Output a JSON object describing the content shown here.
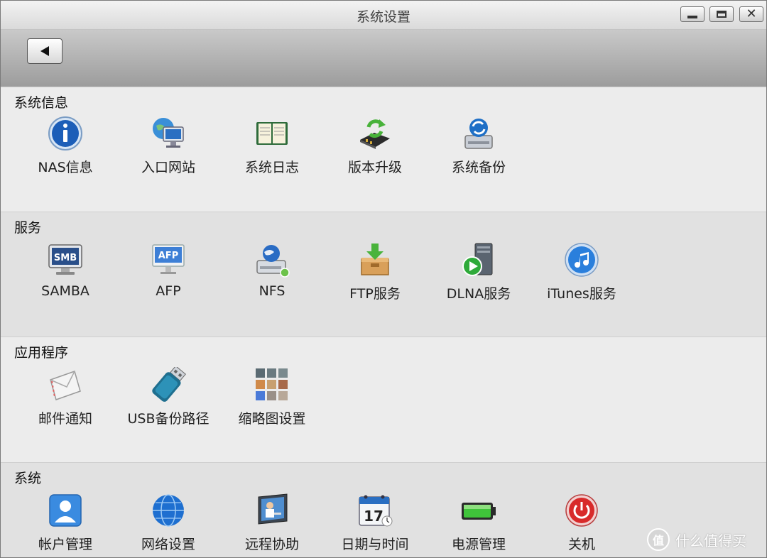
{
  "window": {
    "title": "系统设置"
  },
  "sections": [
    {
      "title": "系统信息",
      "items": [
        {
          "label": "NAS信息",
          "icon": "info-icon"
        },
        {
          "label": "入口网站",
          "icon": "web-portal-icon"
        },
        {
          "label": "系统日志",
          "icon": "log-book-icon"
        },
        {
          "label": "版本升级",
          "icon": "firmware-upgrade-icon"
        },
        {
          "label": "系统备份",
          "icon": "system-backup-icon"
        }
      ]
    },
    {
      "title": "服务",
      "items": [
        {
          "label": "SAMBA",
          "icon": "samba-icon",
          "text": "SMB"
        },
        {
          "label": "AFP",
          "icon": "afp-icon",
          "text": "AFP"
        },
        {
          "label": "NFS",
          "icon": "nfs-icon"
        },
        {
          "label": "FTP服务",
          "icon": "ftp-icon"
        },
        {
          "label": "DLNA服务",
          "icon": "dlna-icon"
        },
        {
          "label": "iTunes服务",
          "icon": "itunes-icon"
        }
      ]
    },
    {
      "title": "应用程序",
      "items": [
        {
          "label": "邮件通知",
          "icon": "mail-icon"
        },
        {
          "label": "USB备份路径",
          "icon": "usb-icon"
        },
        {
          "label": "缩略图设置",
          "icon": "thumbnail-grid-icon"
        }
      ]
    },
    {
      "title": "系统",
      "items": [
        {
          "label": "帐户管理",
          "icon": "account-icon"
        },
        {
          "label": "网络设置",
          "icon": "globe-icon"
        },
        {
          "label": "远程协助",
          "icon": "remote-assist-icon"
        },
        {
          "label": "日期与时间",
          "icon": "calendar-icon",
          "text": "17"
        },
        {
          "label": "电源管理",
          "icon": "battery-icon"
        },
        {
          "label": "关机",
          "icon": "power-icon"
        }
      ]
    }
  ],
  "watermark": {
    "text": "什么值得买",
    "logo": "值"
  },
  "colors": {
    "toolbar": "#a9a9a9",
    "section_light": "#ececec",
    "section_dark": "#e1e1e1"
  }
}
